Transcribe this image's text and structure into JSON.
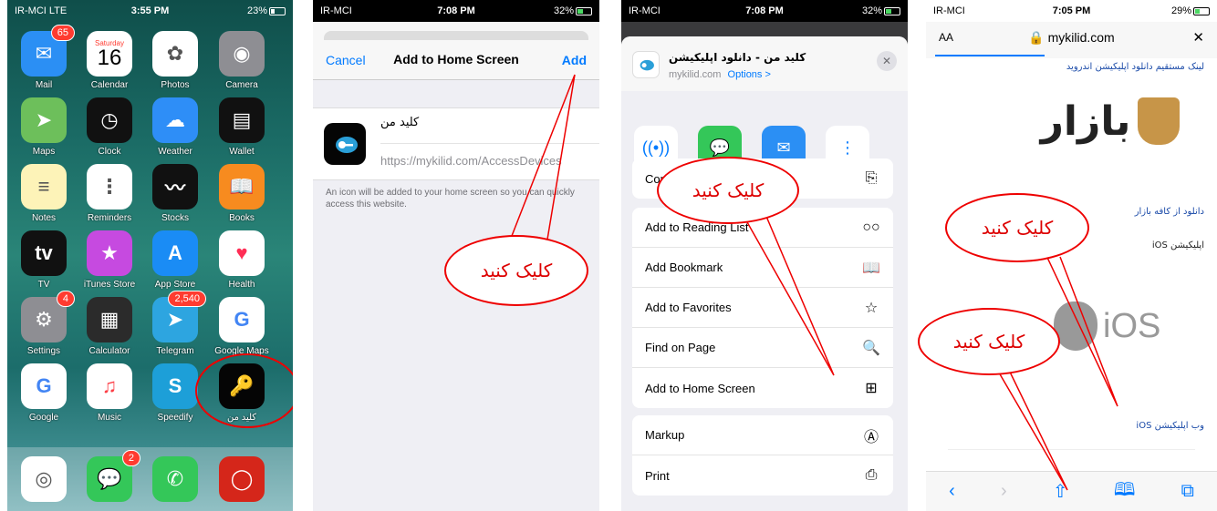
{
  "panel1": {
    "status": {
      "carrier": "IR-MCI  LTE",
      "time": "3:55 PM",
      "battery": "23%"
    },
    "calendar": {
      "weekday": "Saturday",
      "day": "16"
    },
    "apps": [
      {
        "label": "Mail",
        "badge": "65",
        "bg": "#2b8ff4",
        "glyph": "✉"
      },
      {
        "label": "Calendar",
        "badge": "",
        "bg": "#ffffff",
        "glyph": ""
      },
      {
        "label": "Photos",
        "badge": "",
        "bg": "#ffffff",
        "glyph": "✿"
      },
      {
        "label": "Camera",
        "badge": "",
        "bg": "#8e8e93",
        "glyph": "◉"
      },
      {
        "label": "Maps",
        "badge": "",
        "bg": "#6dbf5b",
        "glyph": "➤"
      },
      {
        "label": "Clock",
        "badge": "",
        "bg": "#111111",
        "glyph": "◷"
      },
      {
        "label": "Weather",
        "badge": "",
        "bg": "#2e8ef7",
        "glyph": "☁"
      },
      {
        "label": "Wallet",
        "badge": "",
        "bg": "#111111",
        "glyph": "▤"
      },
      {
        "label": "Notes",
        "badge": "",
        "bg": "#fdf3b8",
        "glyph": "≡"
      },
      {
        "label": "Reminders",
        "badge": "",
        "bg": "#ffffff",
        "glyph": "⋮"
      },
      {
        "label": "Stocks",
        "badge": "",
        "bg": "#111111",
        "glyph": "〰"
      },
      {
        "label": "Books",
        "badge": "",
        "bg": "#f78b1f",
        "glyph": "📖"
      },
      {
        "label": "TV",
        "badge": "",
        "bg": "#111111",
        "glyph": "tv"
      },
      {
        "label": "iTunes Store",
        "badge": "",
        "bg": "#c64ae0",
        "glyph": "★"
      },
      {
        "label": "App Store",
        "badge": "",
        "bg": "#1a8cf5",
        "glyph": "A"
      },
      {
        "label": "Health",
        "badge": "",
        "bg": "#ffffff",
        "glyph": "♥"
      },
      {
        "label": "Settings",
        "badge": "4",
        "bg": "#8e8e93",
        "glyph": "⚙"
      },
      {
        "label": "Calculator",
        "badge": "",
        "bg": "#2b2b2b",
        "glyph": "▦"
      },
      {
        "label": "Telegram",
        "badge": "2,540",
        "bg": "#2da5e0",
        "glyph": "➤"
      },
      {
        "label": "Google Maps",
        "badge": "",
        "bg": "#ffffff",
        "glyph": "G"
      },
      {
        "label": "Google",
        "badge": "",
        "bg": "#ffffff",
        "glyph": "G"
      },
      {
        "label": "Music",
        "badge": "",
        "bg": "#ffffff",
        "glyph": "♫"
      },
      {
        "label": "Speedify",
        "badge": "",
        "bg": "#1d9fd8",
        "glyph": "S"
      },
      {
        "label": "کلید من",
        "badge": "",
        "bg": "#050505",
        "glyph": "🔑"
      }
    ],
    "dock": [
      {
        "label": "Safari",
        "badge": "",
        "bg": "#ffffff",
        "glyph": "◎"
      },
      {
        "label": "Messages",
        "badge": "2",
        "bg": "#34c759",
        "glyph": "💬"
      },
      {
        "label": "Phone",
        "badge": "",
        "bg": "#34c759",
        "glyph": "✆"
      },
      {
        "label": "Opera",
        "badge": "",
        "bg": "#d5261a",
        "glyph": "◯"
      }
    ]
  },
  "panel2": {
    "status": {
      "carrier": "IR-MCI",
      "time": "7:08 PM",
      "battery": "32%"
    },
    "cancel": "Cancel",
    "title": "Add to Home Screen",
    "add": "Add",
    "app_name": "کلید من",
    "url": "https://mykilid.com/AccessDevices",
    "note": "An icon will be added to your home screen so you can quickly access this website."
  },
  "panel3": {
    "status": {
      "carrier": "IR-MCI",
      "time": "7:08 PM",
      "battery": "32%"
    },
    "site_title": "کلید من - دانلود اپلیکیشن",
    "site_domain": "mykilid.com",
    "options": "Options >",
    "share_apps": [
      "AirDrop",
      "Messages",
      "Mail",
      "Reminders"
    ],
    "group1": [
      {
        "label": "Copy",
        "icon": "⎘"
      }
    ],
    "group2": [
      {
        "label": "Add to Reading List",
        "icon": "○○"
      },
      {
        "label": "Add Bookmark",
        "icon": "📖"
      },
      {
        "label": "Add to Favorites",
        "icon": "☆"
      },
      {
        "label": "Find on Page",
        "icon": "🔍"
      },
      {
        "label": "Add to Home Screen",
        "icon": "⊞"
      }
    ],
    "group3": [
      {
        "label": "Markup",
        "icon": "Ⓐ"
      },
      {
        "label": "Print",
        "icon": "⎙"
      }
    ]
  },
  "panel4": {
    "status": {
      "carrier": "IR-MCI",
      "time": "7:05 PM",
      "battery": "29%"
    },
    "aa": "AA",
    "domain": "mykilid.com",
    "close": "✕",
    "link_android": "لینک مستقیم دانلود اپلیکیشن اندروید",
    "bazaar_logo": "بازار",
    "link_bazaar": "دانلود از کافه بازار",
    "ios_app": "اپلیکیشن iOS",
    "ios_logo": "iOS",
    "web_app": "وب اپلیکیشن iOS"
  },
  "callouts": {
    "click_here": "کلیک کنید"
  }
}
